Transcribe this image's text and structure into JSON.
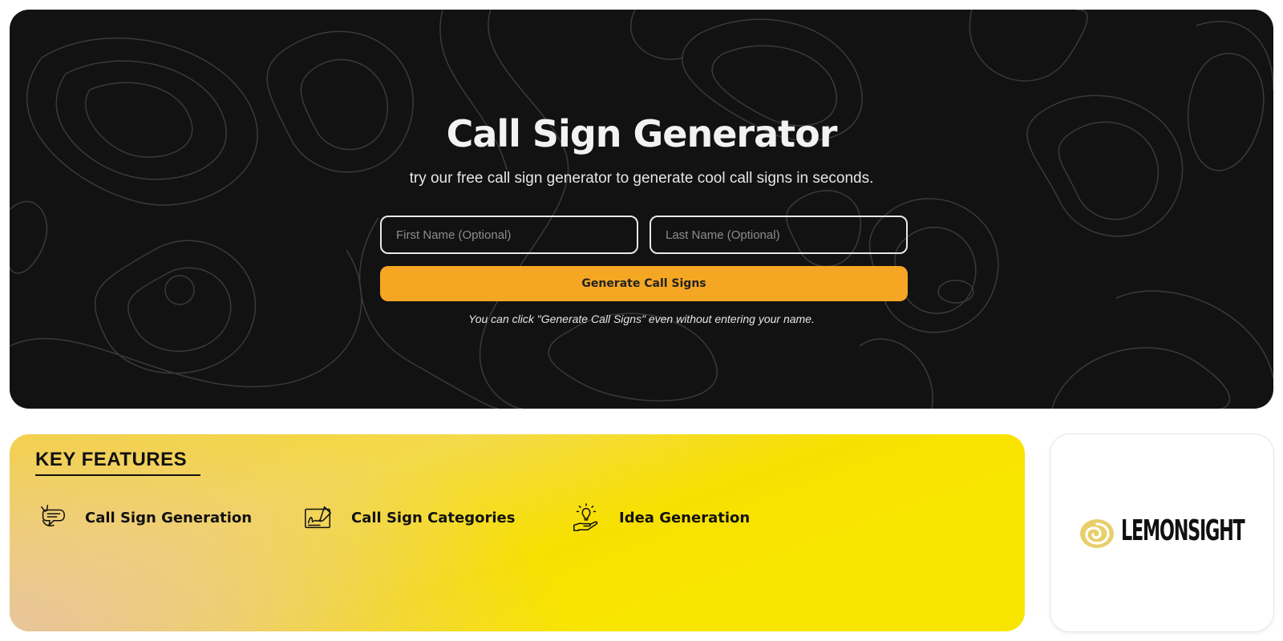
{
  "hero": {
    "title": "Call Sign Generator",
    "subtitle": "try our free call sign generator to generate cool call signs in seconds.",
    "first_name_placeholder": "First Name (Optional)",
    "last_name_placeholder": "Last Name (Optional)",
    "generate_label": "Generate Call Signs",
    "hint": "You can click \"Generate Call Signs\" even without entering your name.",
    "accent_color": "#f5a623"
  },
  "features": {
    "title": "KEY FEATURES",
    "items": [
      {
        "label": "Call Sign Generation",
        "icon": "radio-speech-icon"
      },
      {
        "label": "Call Sign Categories",
        "icon": "signature-pen-icon"
      },
      {
        "label": "Idea Generation",
        "icon": "lightbulb-hand-icon"
      }
    ]
  },
  "brand": {
    "name": "LEMONSIGHT",
    "logo_color": "#e8cf6a"
  }
}
